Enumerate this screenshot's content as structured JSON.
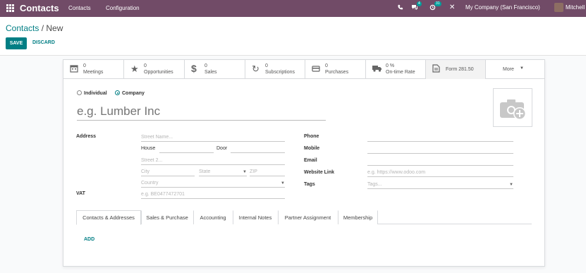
{
  "navbar": {
    "brand": "Contacts",
    "menu": [
      "Contacts",
      "Configuration"
    ],
    "messages_count": "4",
    "activities_count": "31",
    "company": "My Company (San Francisco)",
    "user": "Mitchell"
  },
  "breadcrumb": {
    "parent": "Contacts",
    "separator": " / ",
    "current": "New"
  },
  "actions": {
    "save": "SAVE",
    "discard": "DISCARD"
  },
  "smart_buttons": [
    {
      "icon": "calendar-icon",
      "value": "0",
      "label": "Meetings"
    },
    {
      "icon": "star-icon",
      "value": "0",
      "label": "Opportunities"
    },
    {
      "icon": "dollar-icon",
      "value": "0",
      "label": "Sales"
    },
    {
      "icon": "refresh-icon",
      "value": "0",
      "label": "Subscriptions"
    },
    {
      "icon": "credit-card-icon",
      "value": "0",
      "label": "Purchases"
    },
    {
      "icon": "truck-icon",
      "value": "0 %",
      "label": "On-time Rate"
    },
    {
      "icon": "file-icon",
      "value": "",
      "label": "Form 281.50"
    },
    {
      "icon": "chevron-down-icon",
      "value": "",
      "label": "More"
    }
  ],
  "company_type": {
    "individual": "Individual",
    "company": "Company",
    "selected": "company"
  },
  "name_placeholder": "e.g. Lumber Inc",
  "address": {
    "label": "Address",
    "street_placeholder": "Street Name...",
    "house_label": "House",
    "door_label": "Door",
    "street2_placeholder": "Street 2...",
    "city_placeholder": "City",
    "state_placeholder": "State",
    "zip_placeholder": "ZIP",
    "country_placeholder": "Country"
  },
  "vat": {
    "label": "VAT",
    "placeholder": "e.g. BE0477472701"
  },
  "contact": {
    "phone_label": "Phone",
    "mobile_label": "Mobile",
    "email_label": "Email",
    "website_label": "Website Link",
    "website_placeholder": "e.g. https://www.odoo.com",
    "tags_label": "Tags",
    "tags_placeholder": "Tags..."
  },
  "tabs": [
    "Contacts & Addresses",
    "Sales & Purchase",
    "Accounting",
    "Internal Notes",
    "Partner Assignment",
    "Membership"
  ],
  "add_label": "ADD",
  "colors": {
    "navbar": "#714b67",
    "accent": "#017e84"
  }
}
